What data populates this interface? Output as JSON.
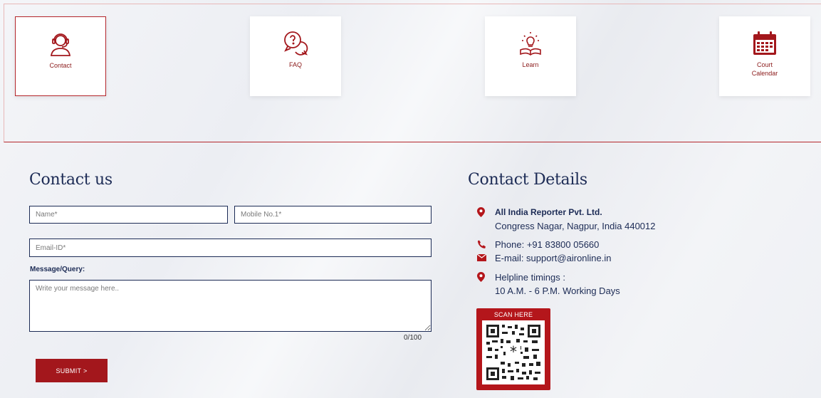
{
  "nav": {
    "tiles": [
      {
        "label": "Contact",
        "icon": "headset-icon"
      },
      {
        "label": "FAQ",
        "icon": "faq-bubbles-icon"
      },
      {
        "label": "Learn",
        "icon": "lightbulb-book-icon"
      },
      {
        "label": "Court\nCalendar",
        "icon": "calendar-icon"
      }
    ]
  },
  "contact_form": {
    "title": "Contact us",
    "name_placeholder": "Name*",
    "mobile_placeholder": "Mobile No.1*",
    "email_placeholder": "Email-ID*",
    "message_label": "Message/Query:",
    "message_placeholder": "Write your message here..",
    "counter": "0/100",
    "submit_label": "SUBMIT >"
  },
  "contact_details": {
    "title": "Contact Details",
    "company": "All India Reporter Pvt. Ltd.",
    "address": "Congress Nagar, Nagpur, India 440012",
    "phone": "Phone: +91 83800 05660",
    "email": "E-mail: support@aironline.in",
    "helpline_label": "Helpline timings :",
    "helpline_hours": "10 A.M. - 6 P.M. Working Days",
    "qr_label": "SCAN HERE"
  },
  "colors": {
    "accent": "#a3171c",
    "navy": "#1c2b55"
  }
}
